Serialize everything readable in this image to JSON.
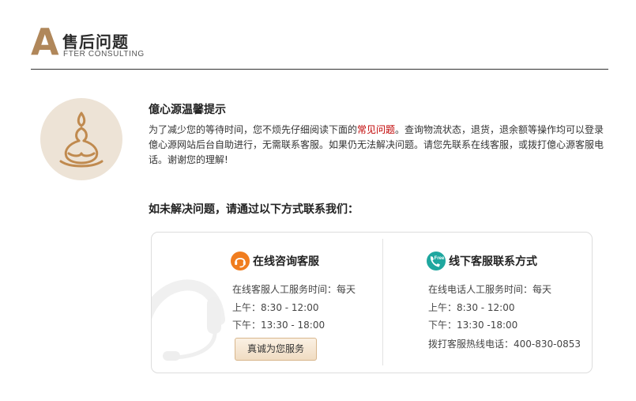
{
  "header": {
    "logo_letter": "A",
    "title": "售后问题",
    "subtitle": "FTER CONSULTING",
    "colors": {
      "brand": "#b0875a",
      "rule": "#333333"
    }
  },
  "tip": {
    "badge_icon": "meditating-buddha-icon",
    "title": "億心源温馨提示",
    "body_before": "为了减少您的等待时间，您不烦先仔细阅读下面的",
    "body_link": "常见问题",
    "body_after": "。查询物流状态，退货，退余额等操作均可以登录億心源网站后台自助进行，无需联系客服。如果仍无法解决问题。请您先联系在线客服，或拨打億心源客服电话。谢谢您的理解!",
    "link_color": "#c00000"
  },
  "contact": {
    "heading": "如未解决问题，请通过以下方式联系我们：",
    "online": {
      "icon": "headset-chat-icon",
      "title": "在线咨询客服",
      "hours_label": "在线客服人工服务时间：每天",
      "morning": "上午：8:30 - 12:00",
      "afternoon": "下午：13:30 - 18:00",
      "button_label": "真诚为您服务"
    },
    "offline": {
      "icon": "free-phone-icon",
      "icon_text": "Free",
      "title": "线下客服联系方式",
      "hours_label": "在线电话人工服务时间：每天",
      "morning": "上午：8:30 - 12:00",
      "afternoon": "下午：13:30 -18:00",
      "hotline": "拨打客服热线电话：400-830-0853"
    }
  }
}
